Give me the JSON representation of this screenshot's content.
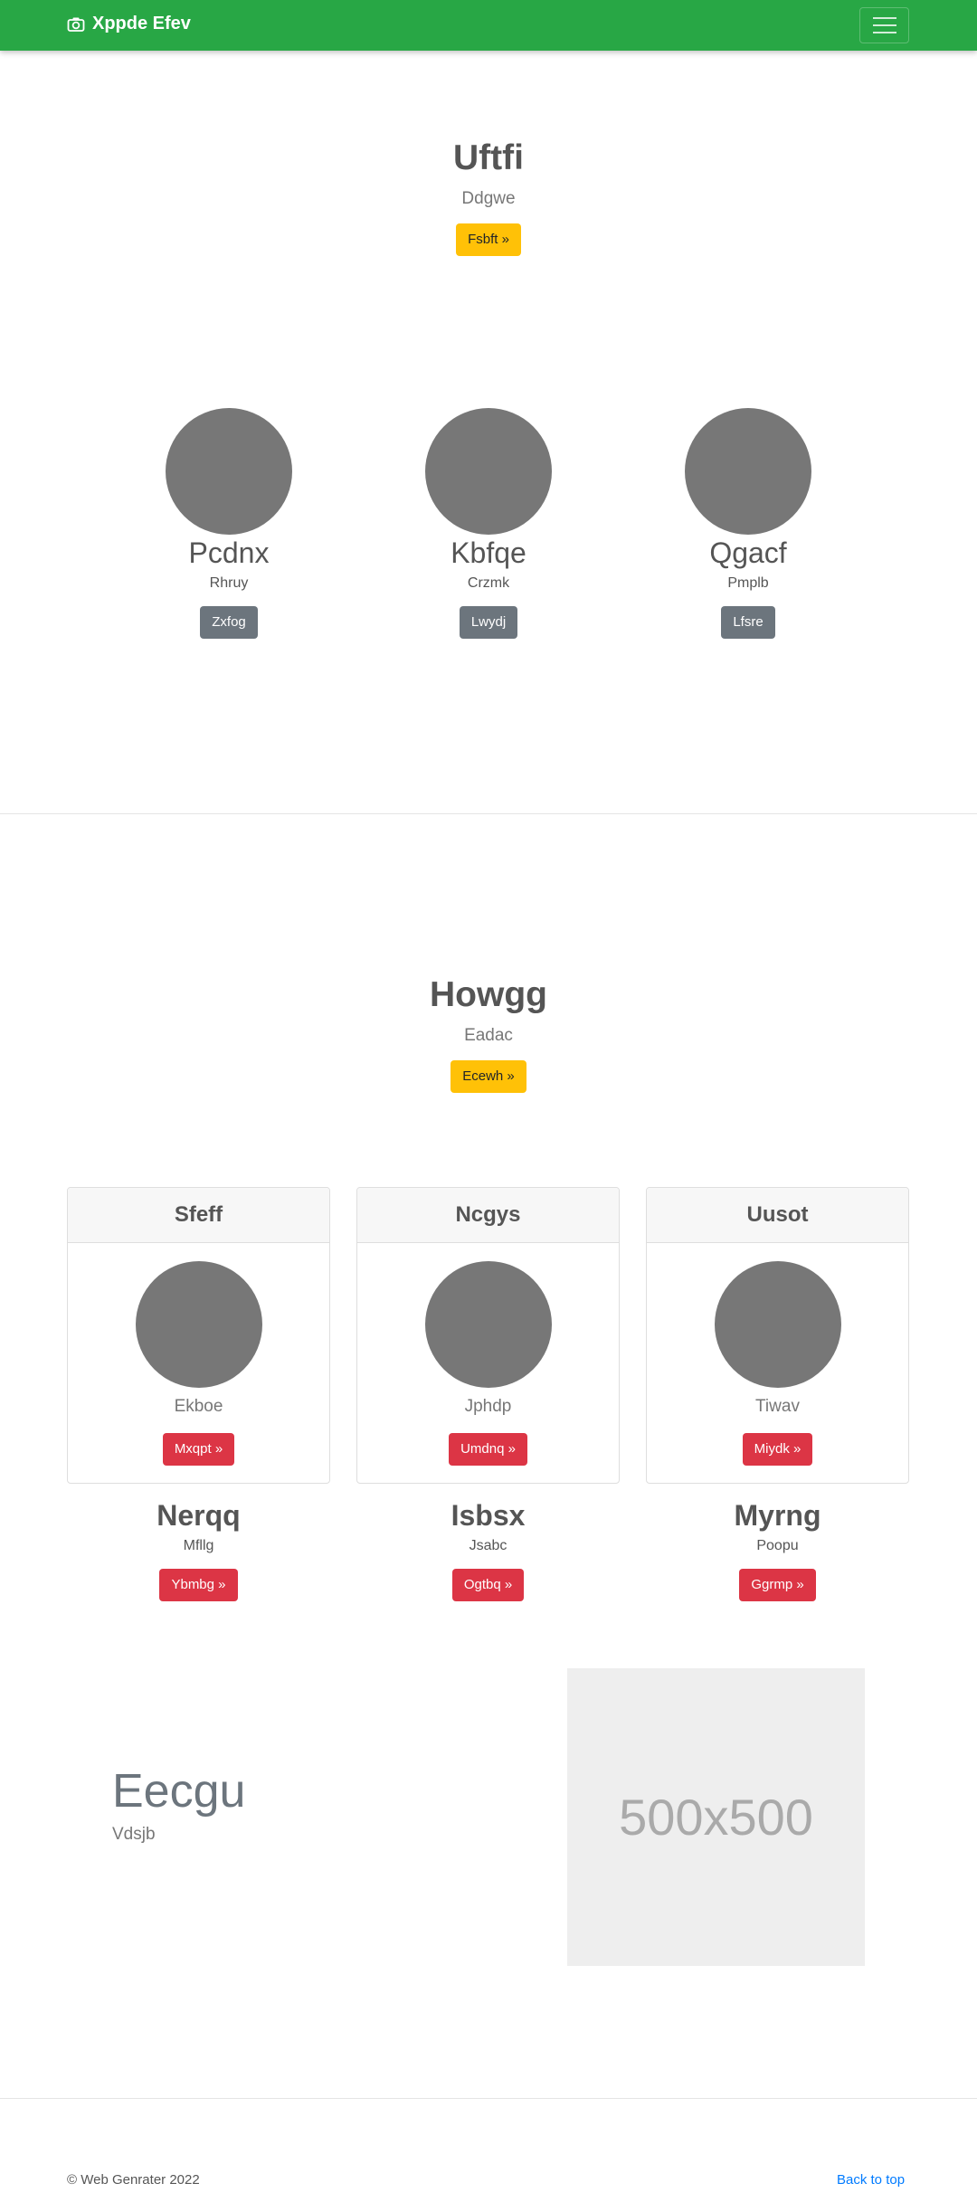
{
  "navbar": {
    "brand": "Xppde Efev",
    "brand_icon": "camera-icon",
    "toggler_icon": "hamburger-icon",
    "color": "#28a745"
  },
  "hero1": {
    "title": "Uftfi",
    "subtitle": "Ddgwe",
    "button": "Fsbft »"
  },
  "features1": [
    {
      "name": "Pcdnx",
      "sub": "Rhruy",
      "button": "Zxfog"
    },
    {
      "name": "Kbfqe",
      "sub": "Crzmk",
      "button": "Lwydj"
    },
    {
      "name": "Qgacf",
      "sub": "Pmplb",
      "button": "Lfsre"
    }
  ],
  "hero2": {
    "title": "Howgg",
    "subtitle": "Eadac",
    "button": "Ecewh »"
  },
  "cards": [
    {
      "header": "Sfeff",
      "sub": "Ekboe",
      "button": "Mxqpt »"
    },
    {
      "header": "Ncgys",
      "sub": "Jphdp",
      "button": "Umdnq »"
    },
    {
      "header": "Uusot",
      "sub": "Tiwav",
      "button": "Miydk »"
    }
  ],
  "under_cards": [
    {
      "name": "Nerqq",
      "sub": "Mfllg",
      "button": "Ybmbg »"
    },
    {
      "name": "Isbsx",
      "sub": "Jsabc",
      "button": "Ogtbq »"
    },
    {
      "name": "Myrng",
      "sub": "Poopu",
      "button": "Ggrmp »"
    }
  ],
  "feature": {
    "title": "Eecgu",
    "subtitle": "Vdsjb",
    "placeholder": "500x500"
  },
  "footer": {
    "copyright": "© Web Genrater 2022",
    "back_to_top": "Back to top"
  }
}
